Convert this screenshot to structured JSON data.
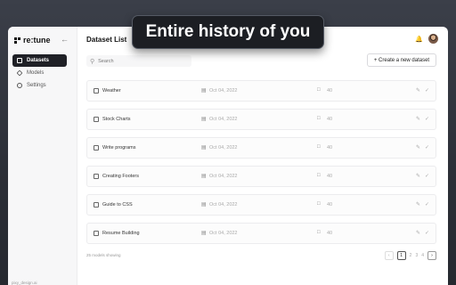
{
  "banner": {
    "text": "Entire history of you"
  },
  "sidebar": {
    "logo_text": "re:tune",
    "items": [
      {
        "label": "Datasets",
        "active": true
      },
      {
        "label": "Models",
        "active": false
      },
      {
        "label": "Settings",
        "active": false
      }
    ],
    "footer": "pixy_design.ai"
  },
  "header": {
    "title": "Dataset List"
  },
  "search": {
    "placeholder": "Search"
  },
  "toolbar": {
    "create_label": "+ Create a new dataset"
  },
  "datasets": [
    {
      "name": "Weather",
      "date": "Oct 04, 2022",
      "count": "40"
    },
    {
      "name": "Stock Charts",
      "date": "Oct 04, 2022",
      "count": "40"
    },
    {
      "name": "Write programs",
      "date": "Oct 04, 2022",
      "count": "40"
    },
    {
      "name": "Creating Footers",
      "date": "Oct 04, 2022",
      "count": "40"
    },
    {
      "name": "Guide to CSS",
      "date": "Oct 04, 2022",
      "count": "40"
    },
    {
      "name": "Resume Building",
      "date": "Oct 04, 2022",
      "count": "40"
    }
  ],
  "footer": {
    "models_showing": "25 models showing"
  },
  "pagination": {
    "pages": [
      "1",
      "2",
      "3",
      "4"
    ],
    "current": "1"
  },
  "colors": {
    "accent": "#1f2026",
    "banner_bg": "#1c1e23",
    "backdrop": "#2f323a"
  }
}
